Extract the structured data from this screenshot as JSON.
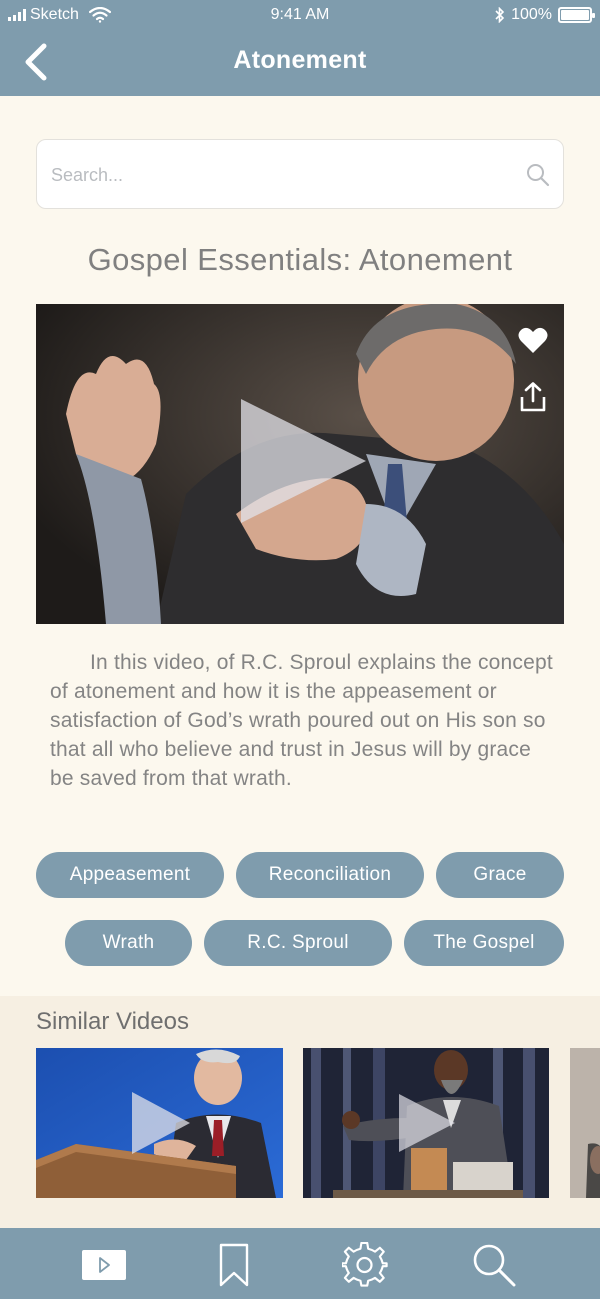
{
  "status_bar": {
    "carrier": "Sketch",
    "time": "9:41 AM",
    "battery": "100%"
  },
  "nav": {
    "title": "Atonement"
  },
  "search": {
    "placeholder": "Search..."
  },
  "video": {
    "title": "Gospel Essentials: Atonement",
    "description": "In this video, of R.C. Sproul explains the concept of atonement and how it is the appeasement or satisfaction of God’s wrath poured out on His son so that all who believe and trust in Jesus will by grace be saved from that wrath."
  },
  "tags": [
    "Appeasement",
    "Reconciliation",
    "Grace",
    "Wrath",
    "R.C. Sproul",
    "The Gospel"
  ],
  "similar": {
    "heading": "Similar Videos"
  },
  "tabbar": {
    "icons": [
      "video-icon",
      "bookmark-icon",
      "gear-icon",
      "search-icon"
    ]
  },
  "colors": {
    "accent": "#7f9cad",
    "background": "#fcf8ee",
    "similar_bg": "#f6efe2"
  }
}
